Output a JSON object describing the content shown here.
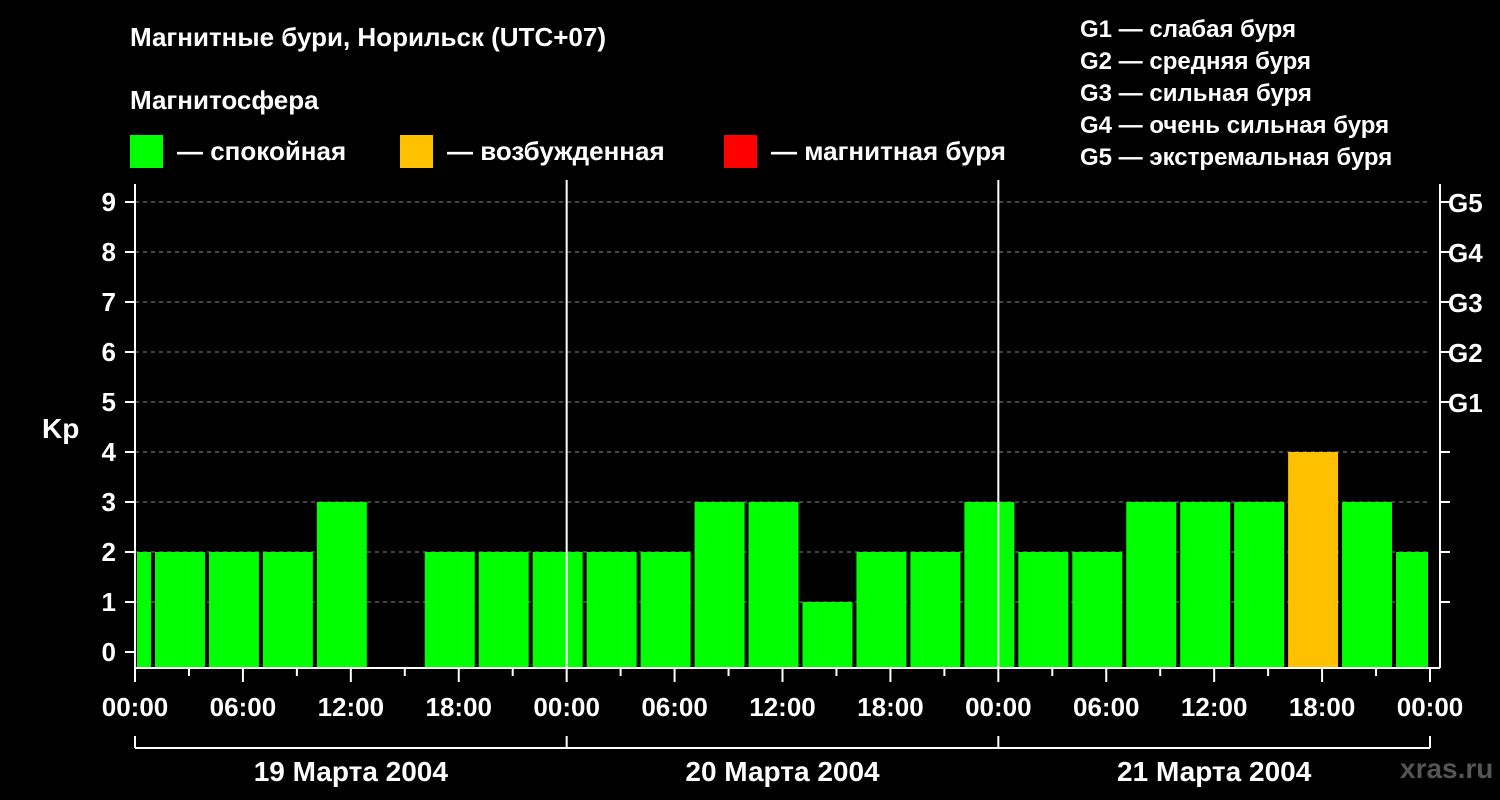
{
  "title": "Магнитные бури, Норильск (UTC+07)",
  "subtitle": "Магнитосфера",
  "legend": [
    {
      "label": "— спокойная",
      "color": "#00ff00"
    },
    {
      "label": "— возбужденная",
      "color": "#ffc000"
    },
    {
      "label": "— магнитная буря",
      "color": "#ff0000"
    }
  ],
  "g_scale": [
    "G1 — слабая буря",
    "G2 — средняя буря",
    "G3 — сильная буря",
    "G4 — очень сильная буря",
    "G5 — экстремальная буря"
  ],
  "watermark": "xras.ru",
  "chart_data": {
    "type": "bar",
    "ylabel": "Kp",
    "ylim": [
      0,
      9
    ],
    "yticks": [
      0,
      1,
      2,
      3,
      4,
      5,
      6,
      7,
      8,
      9
    ],
    "right_axis_labels": [
      {
        "value": 5,
        "label": "G1"
      },
      {
        "value": 6,
        "label": "G2"
      },
      {
        "value": 7,
        "label": "G3"
      },
      {
        "value": 8,
        "label": "G4"
      },
      {
        "value": 9,
        "label": "G5"
      }
    ],
    "xticks": [
      "00:00",
      "06:00",
      "12:00",
      "18:00",
      "00:00",
      "06:00",
      "12:00",
      "18:00",
      "00:00",
      "06:00",
      "12:00",
      "18:00",
      "00:00"
    ],
    "days": [
      "19 Марта 2004",
      "20 Марта 2004",
      "21 Марта 2004"
    ],
    "bars": [
      {
        "start": "19 Марта 2004 00:00",
        "end": "19 Марта 2004 01:00",
        "kp": 2,
        "status": "спокойная"
      },
      {
        "start": "19 Марта 2004 01:00",
        "end": "19 Марта 2004 04:00",
        "kp": 2,
        "status": "спокойная"
      },
      {
        "start": "19 Марта 2004 04:00",
        "end": "19 Марта 2004 07:00",
        "kp": 2,
        "status": "спокойная"
      },
      {
        "start": "19 Марта 2004 07:00",
        "end": "19 Марта 2004 10:00",
        "kp": 2,
        "status": "спокойная"
      },
      {
        "start": "19 Марта 2004 10:00",
        "end": "19 Марта 2004 13:00",
        "kp": 3,
        "status": "спокойная"
      },
      {
        "start": "19 Марта 2004 16:00",
        "end": "19 Марта 2004 19:00",
        "kp": 2,
        "status": "спокойная"
      },
      {
        "start": "19 Марта 2004 19:00",
        "end": "19 Марта 2004 22:00",
        "kp": 2,
        "status": "спокойная"
      },
      {
        "start": "19 Марта 2004 22:00",
        "end": "20 Марта 2004 01:00",
        "kp": 2,
        "status": "спокойная"
      },
      {
        "start": "20 Марта 2004 01:00",
        "end": "20 Марта 2004 04:00",
        "kp": 2,
        "status": "спокойная"
      },
      {
        "start": "20 Марта 2004 04:00",
        "end": "20 Марта 2004 07:00",
        "kp": 2,
        "status": "спокойная"
      },
      {
        "start": "20 Марта 2004 07:00",
        "end": "20 Марта 2004 10:00",
        "kp": 3,
        "status": "спокойная"
      },
      {
        "start": "20 Марта 2004 10:00",
        "end": "20 Марта 2004 13:00",
        "kp": 3,
        "status": "спокойная"
      },
      {
        "start": "20 Марта 2004 13:00",
        "end": "20 Марта 2004 16:00",
        "kp": 1,
        "status": "спокойная"
      },
      {
        "start": "20 Марта 2004 16:00",
        "end": "20 Марта 2004 19:00",
        "kp": 2,
        "status": "спокойная"
      },
      {
        "start": "20 Марта 2004 19:00",
        "end": "20 Марта 2004 22:00",
        "kp": 2,
        "status": "спокойная"
      },
      {
        "start": "20 Марта 2004 22:00",
        "end": "21 Марта 2004 01:00",
        "kp": 3,
        "status": "спокойная"
      },
      {
        "start": "21 Марта 2004 01:00",
        "end": "21 Марта 2004 04:00",
        "kp": 2,
        "status": "спокойная"
      },
      {
        "start": "21 Марта 2004 04:00",
        "end": "21 Марта 2004 07:00",
        "kp": 2,
        "status": "спокойная"
      },
      {
        "start": "21 Марта 2004 07:00",
        "end": "21 Марта 2004 10:00",
        "kp": 3,
        "status": "спокойная"
      },
      {
        "start": "21 Марта 2004 10:00",
        "end": "21 Марта 2004 13:00",
        "kp": 3,
        "status": "спокойная"
      },
      {
        "start": "21 Марта 2004 13:00",
        "end": "21 Марта 2004 16:00",
        "kp": 3,
        "status": "спокойная"
      },
      {
        "start": "21 Марта 2004 16:00",
        "end": "21 Марта 2004 19:00",
        "kp": 4,
        "status": "возбужденная"
      },
      {
        "start": "21 Марта 2004 19:00",
        "end": "21 Марта 2004 22:00",
        "kp": 3,
        "status": "спокойная"
      },
      {
        "start": "21 Марта 2004 22:00",
        "end": "22 Марта 2004 00:00",
        "kp": 2,
        "status": "спокойная"
      }
    ],
    "colors": {
      "спокойная": "#00ff00",
      "возбужденная": "#ffc000",
      "магнитная буря": "#ff0000"
    },
    "grid": true
  }
}
